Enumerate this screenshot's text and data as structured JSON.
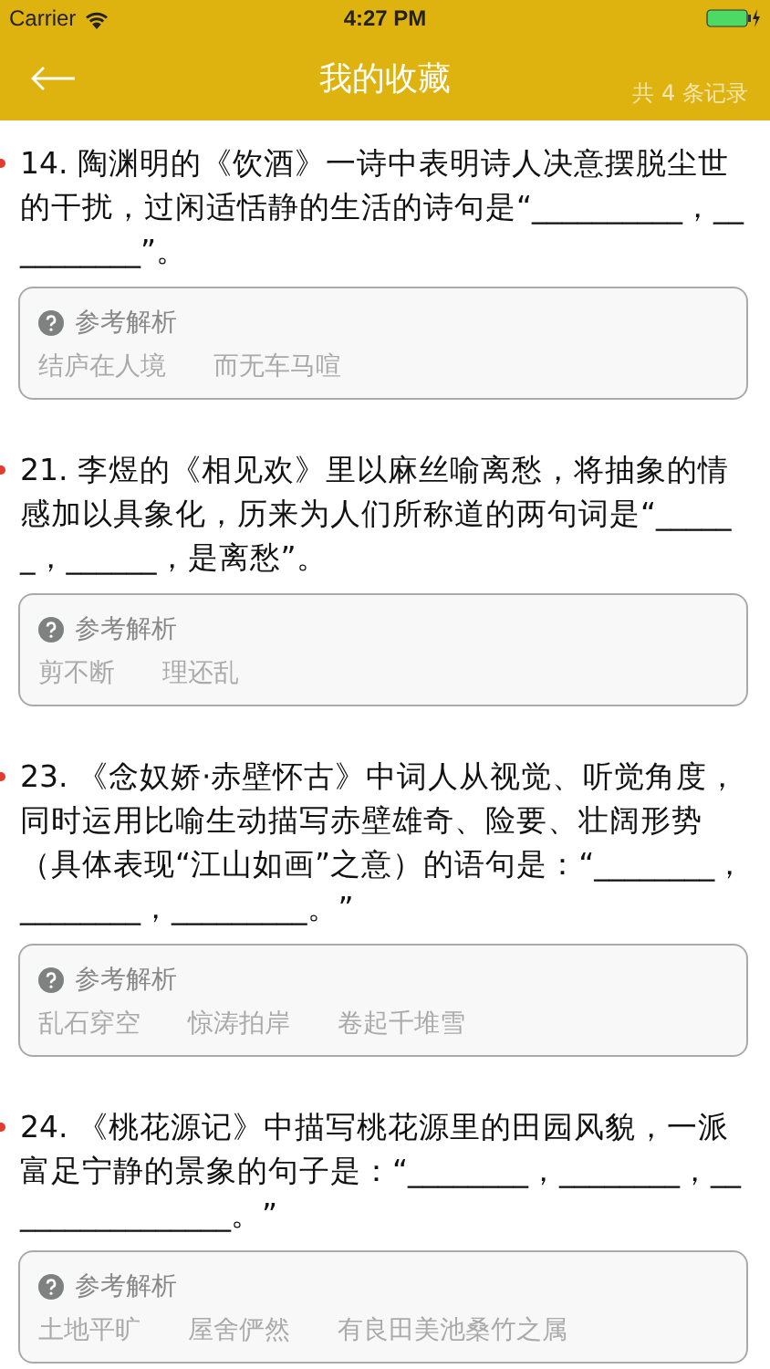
{
  "status_bar": {
    "carrier": "Carrier",
    "time": "4:27 PM"
  },
  "nav": {
    "title": "我的收藏",
    "count": "共 4 条记录"
  },
  "questions": [
    {
      "text": "14. 陶渊明的《饮酒》一诗中表明诗人决意摆脱尘世的干扰，过闲适恬静的生活的诗句是“__________，__________”。",
      "analysis_label": "参考解析",
      "answers": [
        "结庐在人境",
        "而无车马喧"
      ]
    },
    {
      "text": "21. 李煜的《相见欢》里以麻丝喻离愁，将抽象的情感加以具象化，历来为人们所称道的两句词是“______，______，是离愁”。",
      "analysis_label": "参考解析",
      "answers": [
        "剪不断",
        "理还乱"
      ]
    },
    {
      "text": "23. 《念奴娇·赤壁怀古》中词人从视觉、听觉角度，同时运用比喻生动描写赤壁雄奇、险要、壮阔形势（具体表现“江山如画”之意）的语句是：“________，________，_________。”",
      "analysis_label": "参考解析",
      "answers": [
        "乱石穿空",
        "惊涛拍岸",
        "卷起千堆雪"
      ]
    },
    {
      "text": "24. 《桃花源记》中描写桃花源里的田园风貌，一派富足宁静的景象的句子是：“________，________，________________。”",
      "analysis_label": "参考解析",
      "answers": [
        "土地平旷",
        "屋舍俨然",
        "有良田美池桑竹之属"
      ]
    }
  ]
}
